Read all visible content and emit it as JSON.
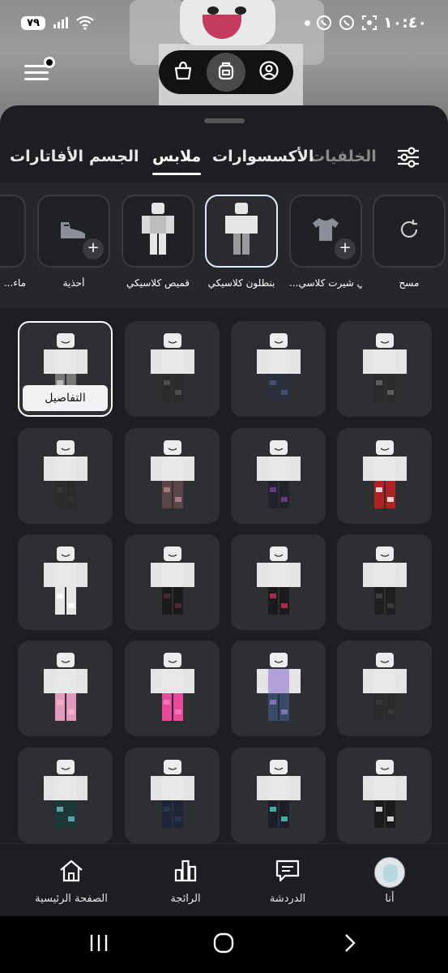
{
  "status_bar": {
    "battery": "٧٩",
    "time": "١٠:٤٠"
  },
  "top_controls": {
    "segments": [
      {
        "icon": "shopping-bag-icon",
        "active": false
      },
      {
        "icon": "backpack-icon",
        "active": true
      },
      {
        "icon": "user-circle-icon",
        "active": false
      }
    ]
  },
  "tabs": [
    {
      "label": "الخلفيات",
      "state": "faded"
    },
    {
      "label": "الأكسسوارات",
      "state": "normal"
    },
    {
      "label": "ملابس",
      "state": "active"
    },
    {
      "label": "الجسم",
      "state": "normal"
    },
    {
      "label": "الأفاتارات",
      "state": "normal"
    }
  ],
  "categories": [
    {
      "label": "مسح",
      "icon": "refresh-icon",
      "selected": false
    },
    {
      "label": "...تي شيرت كلاسي",
      "icon": "tshirt-icon",
      "selected": false
    },
    {
      "label": "بنطلون كلاسيكي",
      "icon": "avatar-thumb",
      "selected": true
    },
    {
      "label": "قميص كلاسيكي",
      "icon": "avatar-thumb",
      "selected": false
    },
    {
      "label": "أحذية",
      "icon": "shoe-icon",
      "selected": false
    },
    {
      "label": "...ماء",
      "icon": "partial",
      "selected": false
    }
  ],
  "grid": {
    "details_label": "التفاصيل",
    "items": [
      {
        "pants": "#2b2b2b",
        "shirt": "#e8e8e8",
        "accent": "#6a6a6a"
      },
      {
        "pants": "#2a2f3d",
        "shirt": "#e8e8e8",
        "accent": "#425a7a"
      },
      {
        "pants": "#2b2b2b",
        "shirt": "#e8e8e8",
        "accent": "#555555"
      },
      {
        "pants": "#777777",
        "shirt": "#e8e8e8",
        "accent": "#d0d0d0",
        "selected": true
      },
      {
        "pants": "#b22222",
        "shirt": "#e8e8e8",
        "accent": "#ffffff"
      },
      {
        "pants": "#22222a",
        "shirt": "#e8e8e8",
        "accent": "#7a3fa0"
      },
      {
        "pants": "#5a4646",
        "shirt": "#e8e8e8",
        "accent": "#b78a8a"
      },
      {
        "pants": "#2b2b2b",
        "shirt": "#e8e8e8",
        "accent": "#3a3a3a"
      },
      {
        "pants": "#1f1f1f",
        "shirt": "#e8e8e8",
        "accent": "#444444"
      },
      {
        "pants": "#1b1b1b",
        "shirt": "#e8e8e8",
        "accent": "#d1305a"
      },
      {
        "pants": "#1b1b1b",
        "shirt": "#e8e8e8",
        "accent": "#5a2a3a"
      },
      {
        "pants": "#e6e6e6",
        "shirt": "#e8e8e8",
        "accent": "#ffffff"
      },
      {
        "pants": "#2b2b2b",
        "shirt": "#e8e8e8",
        "accent": "#3b3b3b"
      },
      {
        "pants": "#3a4a6a",
        "shirt": "#b2a0d8",
        "accent": "#8f7cc7"
      },
      {
        "pants": "#e84a9a",
        "shirt": "#e8e8e8",
        "accent": "#ff7ac0"
      },
      {
        "pants": "#e59abd",
        "shirt": "#e8e8e8",
        "accent": "#f2b6d0"
      },
      {
        "pants": "#1b1b1b",
        "shirt": "#e8e8e8",
        "accent": "#ffffff"
      },
      {
        "pants": "#1c1f2a",
        "shirt": "#e8e8e8",
        "accent": "#4ad0c0"
      },
      {
        "pants": "#1d2538",
        "shirt": "#e8e8e8",
        "accent": "#2b3a5a"
      },
      {
        "pants": "#1a3a3a",
        "shirt": "#e8e8e8",
        "accent": "#6fbfbf"
      }
    ]
  },
  "bottom_nav": [
    {
      "label": "أنا",
      "icon": "avatar"
    },
    {
      "label": "الدردشة",
      "icon": "chat-icon"
    },
    {
      "label": "الرائجة",
      "icon": "chart-icon"
    },
    {
      "label": "الصفحة الرئيسية",
      "icon": "home-icon"
    }
  ]
}
